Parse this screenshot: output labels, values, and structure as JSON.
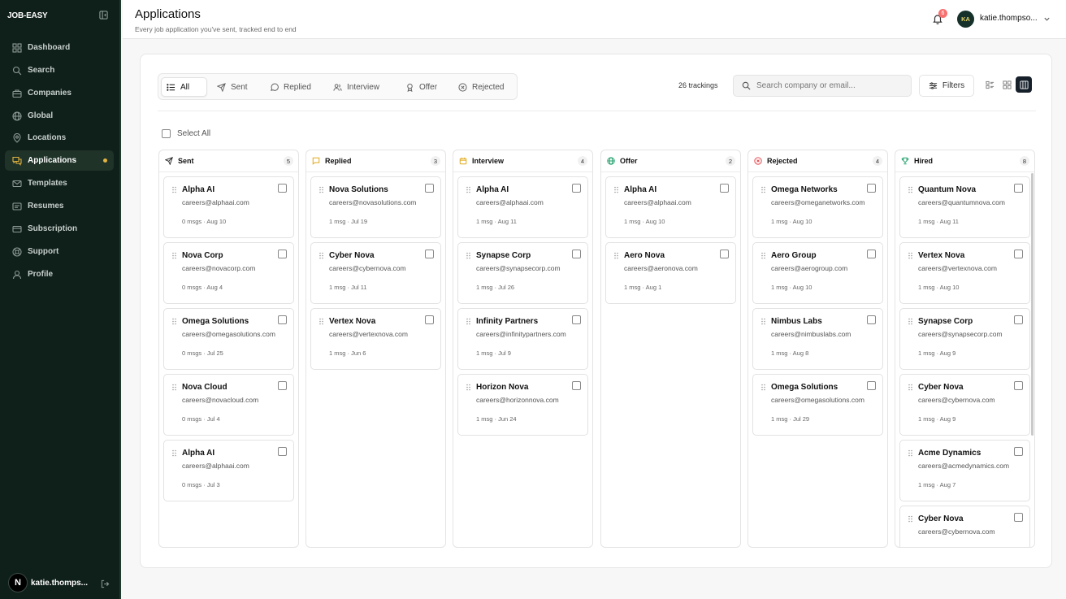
{
  "sidebar": {
    "brand": "JOB-EASY",
    "items": [
      {
        "label": "Dashboard",
        "icon": "dashboard-icon"
      },
      {
        "label": "Search",
        "icon": "search-icon"
      },
      {
        "label": "Companies",
        "icon": "briefcase-icon"
      },
      {
        "label": "Global",
        "icon": "globe-icon"
      },
      {
        "label": "Locations",
        "icon": "map-pin-icon"
      },
      {
        "label": "Applications",
        "icon": "chat-bubbles-icon",
        "active": true
      },
      {
        "label": "Templates",
        "icon": "mail-icon"
      },
      {
        "label": "Resumes",
        "icon": "file-icon"
      },
      {
        "label": "Subscription",
        "icon": "credit-card-icon"
      },
      {
        "label": "Support",
        "icon": "lifebuoy-icon"
      },
      {
        "label": "Profile",
        "icon": "user-icon"
      }
    ],
    "user": {
      "initial": "N",
      "name": "katie.thomps..."
    }
  },
  "header": {
    "title": "Applications",
    "subtitle": "Every job application you've sent, tracked end to end",
    "notification_count": "6",
    "avatar_initials": "KA",
    "username": "katie.thompso..."
  },
  "toolbar": {
    "tabs": [
      {
        "label": "All",
        "icon": "list-icon",
        "active": true
      },
      {
        "label": "Sent",
        "icon": "send-icon"
      },
      {
        "label": "Replied",
        "icon": "message-circle-icon"
      },
      {
        "label": "Interview",
        "icon": "users-icon"
      },
      {
        "label": "Offer",
        "icon": "award-icon"
      },
      {
        "label": "Rejected",
        "icon": "x-circle-icon"
      }
    ],
    "tracking_count": "26 trackings",
    "search_placeholder": "Search company or email...",
    "filters_label": "Filters",
    "views": [
      "list-view-icon",
      "grid-view-icon",
      "board-view-icon"
    ],
    "active_view": "board-view-icon"
  },
  "select_all_label": "Select All",
  "columns": [
    {
      "title": "Sent",
      "count": "5",
      "icon": "send-icon",
      "color": "#333333",
      "cards": [
        {
          "company": "Alpha AI",
          "email": "careers@alphaai.com",
          "meta": "0 msgs · Aug 10"
        },
        {
          "company": "Nova Corp",
          "email": "careers@novacorp.com",
          "meta": "0 msgs · Aug 4"
        },
        {
          "company": "Omega Solutions",
          "email": "careers@omegasolutions.com",
          "meta": "0 msgs · Jul 25"
        },
        {
          "company": "Nova Cloud",
          "email": "careers@novacloud.com",
          "meta": "0 msgs · Jul 4"
        },
        {
          "company": "Alpha AI",
          "email": "careers@alphaai.com",
          "meta": "0 msgs · Jul 3"
        }
      ]
    },
    {
      "title": "Replied",
      "count": "3",
      "icon": "message-square-icon",
      "color": "#e0a91b",
      "cards": [
        {
          "company": "Nova Solutions",
          "email": "careers@novasolutions.com",
          "meta": "1 msg · Jul 19"
        },
        {
          "company": "Cyber Nova",
          "email": "careers@cybernova.com",
          "meta": "1 msg · Jul 11"
        },
        {
          "company": "Vertex Nova",
          "email": "careers@vertexnova.com",
          "meta": "1 msg · Jun 6"
        }
      ]
    },
    {
      "title": "Interview",
      "count": "4",
      "icon": "calendar-icon",
      "color": "#e0a91b",
      "cards": [
        {
          "company": "Alpha AI",
          "email": "careers@alphaai.com",
          "meta": "1 msg · Aug 11"
        },
        {
          "company": "Synapse Corp",
          "email": "careers@synapsecorp.com",
          "meta": "1 msg · Jul 26"
        },
        {
          "company": "Infinity Partners",
          "email": "careers@infinitypartners.com",
          "meta": "1 msg · Jul 9"
        },
        {
          "company": "Horizon Nova",
          "email": "careers@horizonnova.com",
          "meta": "1 msg · Jun 24"
        }
      ]
    },
    {
      "title": "Offer",
      "count": "2",
      "icon": "globe-icon",
      "color": "#22a06b",
      "cards": [
        {
          "company": "Alpha AI",
          "email": "careers@alphaai.com",
          "meta": "1 msg · Aug 10"
        },
        {
          "company": "Aero Nova",
          "email": "careers@aeronova.com",
          "meta": "1 msg · Aug 1"
        }
      ]
    },
    {
      "title": "Rejected",
      "count": "4",
      "icon": "x-circle-icon",
      "color": "#e5484d",
      "cards": [
        {
          "company": "Omega Networks",
          "email": "careers@omeganetworks.com",
          "meta": "1 msg · Aug 10"
        },
        {
          "company": "Aero Group",
          "email": "careers@aerogroup.com",
          "meta": "1 msg · Aug 10"
        },
        {
          "company": "Nimbus Labs",
          "email": "careers@nimbuslabs.com",
          "meta": "1 msg · Aug 8"
        },
        {
          "company": "Omega Solutions",
          "email": "careers@omegasolutions.com",
          "meta": "1 msg · Jul 29"
        }
      ]
    },
    {
      "title": "Hired",
      "count": "8",
      "icon": "trophy-icon",
      "color": "#22a06b",
      "cards": [
        {
          "company": "Quantum Nova",
          "email": "careers@quantumnova.com",
          "meta": "1 msg · Aug 11"
        },
        {
          "company": "Vertex Nova",
          "email": "careers@vertexnova.com",
          "meta": "1 msg · Aug 10"
        },
        {
          "company": "Synapse Corp",
          "email": "careers@synapsecorp.com",
          "meta": "1 msg · Aug 9"
        },
        {
          "company": "Cyber Nova",
          "email": "careers@cybernova.com",
          "meta": "1 msg · Aug 9"
        },
        {
          "company": "Acme Dynamics",
          "email": "careers@acmedynamics.com",
          "meta": "1 msg · Aug 7"
        },
        {
          "company": "Cyber Nova",
          "email": "careers@cybernova.com",
          "meta": ""
        }
      ]
    }
  ]
}
